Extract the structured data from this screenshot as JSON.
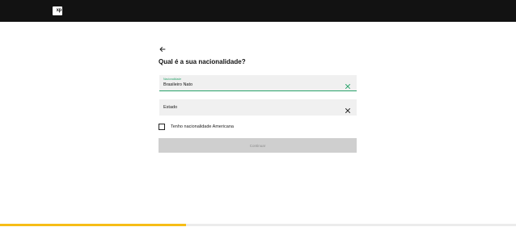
{
  "header": {
    "logo_text": "xp"
  },
  "page": {
    "title": "Qual é a sua nacionalidade?"
  },
  "nationality_field": {
    "label": "Nacionalidade",
    "value": "Brasileiro Nato"
  },
  "state_field": {
    "placeholder": "Estado"
  },
  "american_checkbox": {
    "label": "Tenho nacionalidade Americana",
    "checked": false
  },
  "continue_button": {
    "label": "Continuar",
    "enabled": false
  },
  "progress": {
    "fraction": 0.36
  },
  "colors": {
    "accent_green": "#2aa36b",
    "progress_yellow": "#f6bd16",
    "topbar": "#121212"
  },
  "icons": {
    "back": "arrow-left-icon",
    "clear": "close-icon"
  }
}
